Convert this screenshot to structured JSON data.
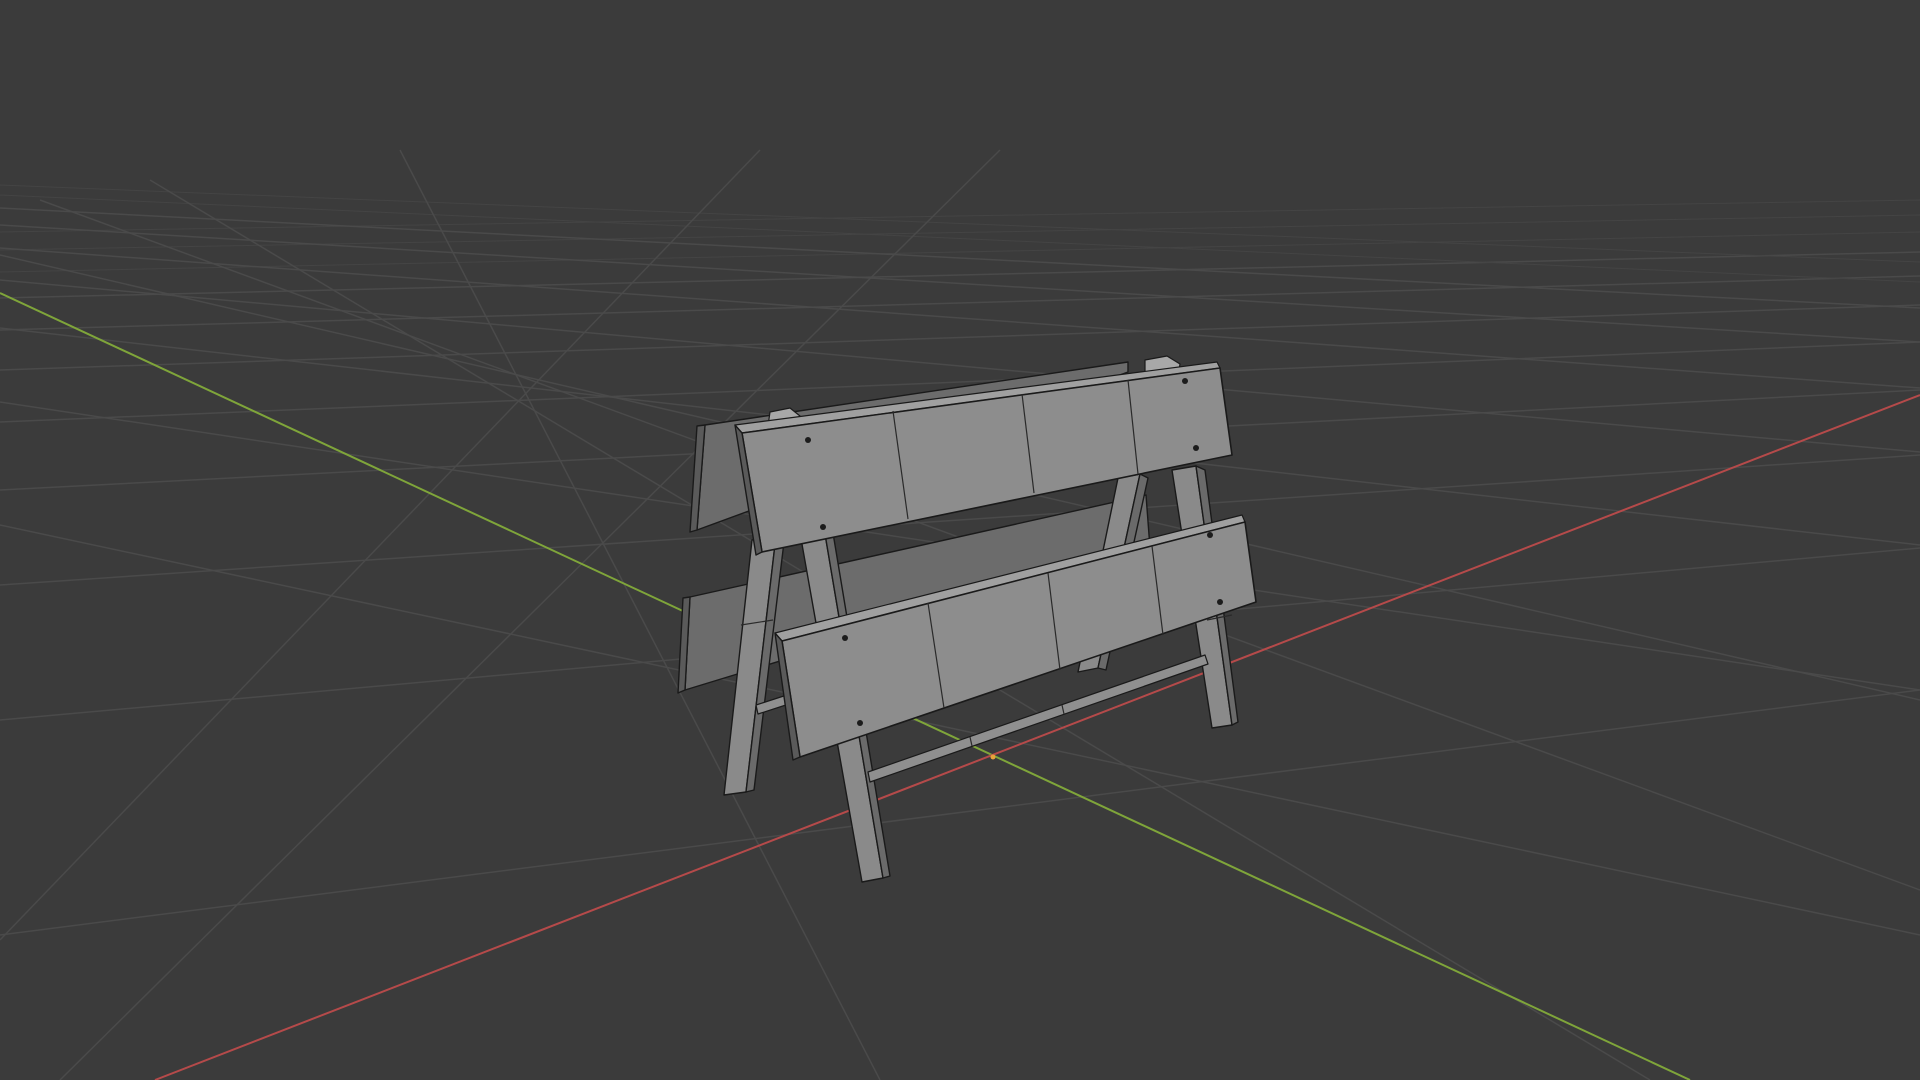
{
  "viewport": {
    "background": "#3b3b3b",
    "grid_color": "#4a4a4a",
    "x_axis_color": "#b54a4a",
    "y_axis_color": "#7fa53a",
    "origin_color": "#e8a33a"
  },
  "scene": {
    "object": "sawhorse-barrier",
    "shading": "solid-wireframe",
    "object_color": "#8d8d8d"
  }
}
